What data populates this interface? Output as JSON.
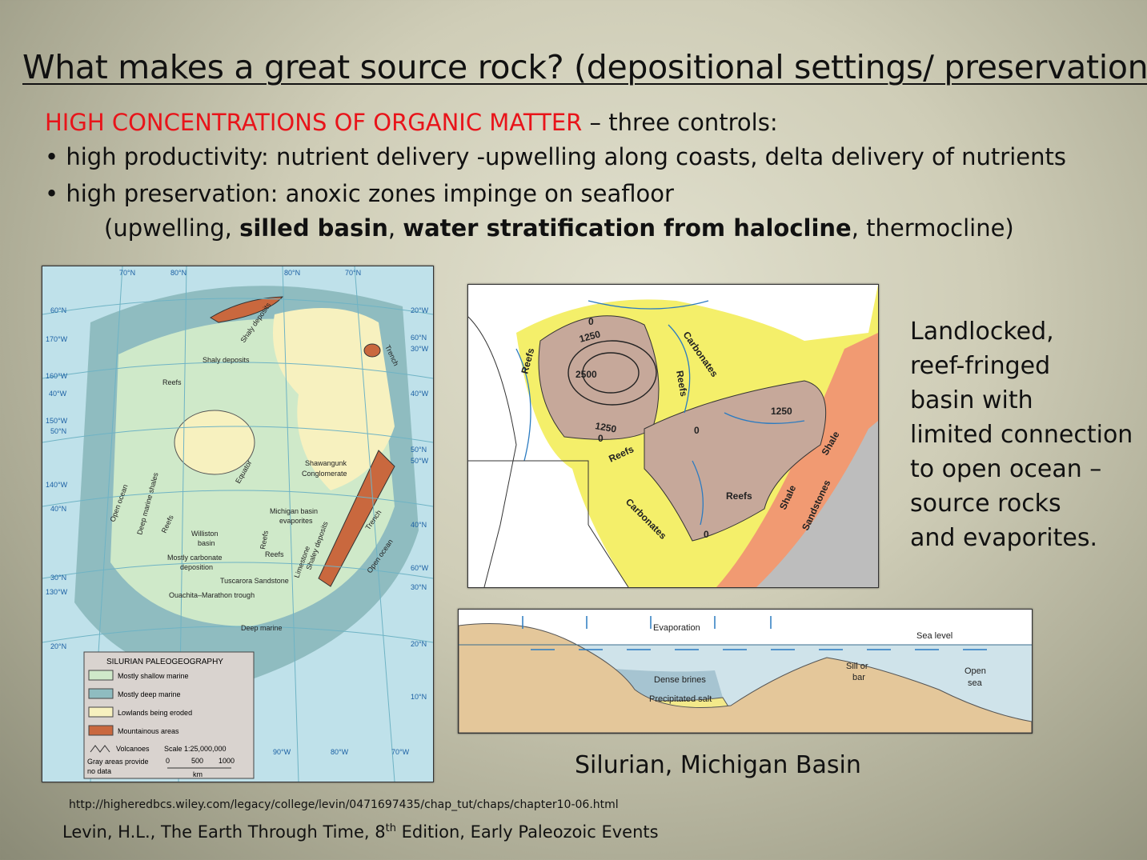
{
  "slide": {
    "title": "What makes a great source rock? (depositional settings/ preservation)",
    "intro_red": "HIGH CONCENTRATIONS OF ORGANIC MATTER",
    "intro_rest": " – three controls:",
    "bullet1": "high productivity: nutrient delivery -upwelling along coasts, delta delivery of nutrients",
    "bullet2": "high preservation: anoxic zones impinge on seafloor",
    "sub_open": "(upwelling, ",
    "sub_b1": "silled basin",
    "sub_comma": ", ",
    "sub_b2": "water stratification from halocline",
    "sub_close": ", thermocline)",
    "bullet_glyph": "•"
  },
  "map": {
    "lat_labels": [
      "60°N",
      "170°W",
      "160°W",
      "40°W",
      "150°W",
      "50°N",
      "140°W",
      "40°N",
      "30°N",
      "130°W",
      "20°N"
    ],
    "top_labels": [
      "70°N",
      "80°N",
      "80°N",
      "70°N"
    ],
    "right_labels": [
      "20°W",
      "60°N",
      "30°W",
      "40°W",
      "50°N",
      "50°W",
      "40°N",
      "60°W",
      "30°N",
      "20°N",
      "10°N"
    ],
    "bottom_labels": [
      "90°W",
      "80°W",
      "70°W"
    ],
    "features": [
      "Shaly deposits",
      "Shaly deposits",
      "Trench",
      "Reefs",
      "Equator",
      "Shawangunk",
      "Conglomerate",
      "Michigan basin",
      "evaporites",
      "Williston",
      "basin",
      "Mostly carbonate",
      "deposition",
      "Reefs",
      "Limestone",
      "Shaley deposits",
      "Reefs",
      "Tuscarora Sandstone",
      "Ouachita–Marathon trough",
      "Deep marine",
      "Open ocean",
      "Deep marine shales",
      "Reefs",
      "Open ocean",
      "Trench"
    ],
    "legend_title": "SILURIAN PALEOGEOGRAPHY",
    "legend_items": [
      {
        "label": "Mostly shallow marine",
        "color": "#cfe9c9"
      },
      {
        "label": "Mostly deep marine",
        "color": "#8fbcc0"
      },
      {
        "label": "Lowlands being eroded",
        "color": "#f7f1bf"
      },
      {
        "label": "Mountainous areas",
        "color": "#c9683e"
      }
    ],
    "volcanoes": "Volcanoes",
    "scale": "Scale 1:25,000,000",
    "gray_note_1": "Gray areas provide",
    "gray_note_2": "no data",
    "scale_ticks": [
      "0",
      "500",
      "1000"
    ],
    "scale_unit": "km"
  },
  "basin_map": {
    "labels": [
      "Reefs",
      "1250",
      "0",
      "Carbonates",
      "2500",
      "Reefs",
      "1250",
      "0",
      "Reefs",
      "0",
      "1250",
      "Shale",
      "Reefs",
      "Shale",
      "Sandstones",
      "Carbonates",
      "0"
    ]
  },
  "cross_section": {
    "evaporation": "Evaporation",
    "sea_level": "Sea level",
    "sill_1": "Sill or",
    "sill_2": "bar",
    "open_1": "Open",
    "open_2": "sea",
    "dense_brines": "Dense brines",
    "precipitated_salt": "Precipitated salt"
  },
  "side_text": [
    "Landlocked,",
    "reef-fringed",
    "basin with",
    "limited connection",
    "to open ocean –",
    "source rocks",
    "and evaporites."
  ],
  "caption": "Silurian, Michigan Basin",
  "url": "http://higheredbcs.wiley.com/legacy/college/levin/0471697435/chap_tut/chaps/chapter10-06.html",
  "citation_pre": "Levin, H.L.,  The Earth Through Time, 8",
  "citation_sup": "th",
  "citation_post": " Edition, Early Paleozoic Events"
}
